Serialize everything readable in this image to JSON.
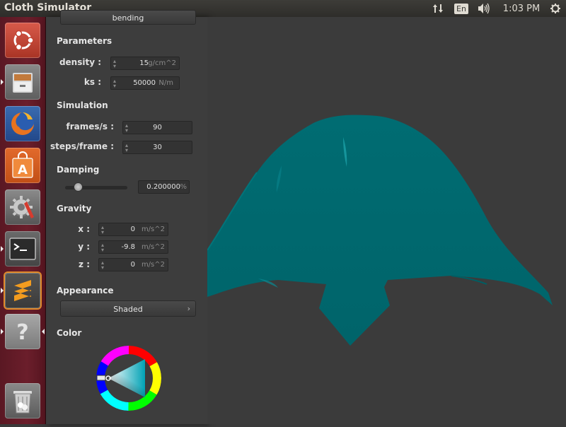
{
  "topbar": {
    "app_title": "Cloth Simulator",
    "language": "En",
    "clock": "1:03 PM"
  },
  "launcher": {
    "items": [
      {
        "name": "Ubuntu Dash"
      },
      {
        "name": "Files"
      },
      {
        "name": "Firefox"
      },
      {
        "name": "Ubuntu Software Center"
      },
      {
        "name": "System Settings"
      },
      {
        "name": "Terminal"
      },
      {
        "name": "Sublime Text"
      },
      {
        "name": "Unknown App"
      },
      {
        "name": "Trash"
      }
    ]
  },
  "panel": {
    "top_button_label": "bending",
    "parameters": {
      "title": "Parameters",
      "density": {
        "label": "density :",
        "value": "15",
        "unit": "g/cm^2"
      },
      "ks": {
        "label": "ks :",
        "value": "50000",
        "unit": "N/m"
      }
    },
    "simulation": {
      "title": "Simulation",
      "frames": {
        "label": "frames/s :",
        "value": "90"
      },
      "steps": {
        "label": "steps/frame :",
        "value": "30"
      }
    },
    "damping": {
      "title": "Damping",
      "value": "0.200000",
      "unit": "%",
      "slider_fraction": 0.2
    },
    "gravity": {
      "title": "Gravity",
      "x": {
        "label": "x :",
        "value": "0",
        "unit": "m/s^2"
      },
      "y": {
        "label": "y :",
        "value": "-9.8",
        "unit": "m/s^2"
      },
      "z": {
        "label": "z :",
        "value": "0",
        "unit": "m/s^2"
      }
    },
    "appearance": {
      "title": "Appearance",
      "mode": "Shaded",
      "chevron": "›"
    },
    "color": {
      "title": "Color",
      "selected_hex": "#007a7f"
    }
  },
  "scene": {
    "cloth_color": "#00666b",
    "background": "#3b3b3b"
  }
}
